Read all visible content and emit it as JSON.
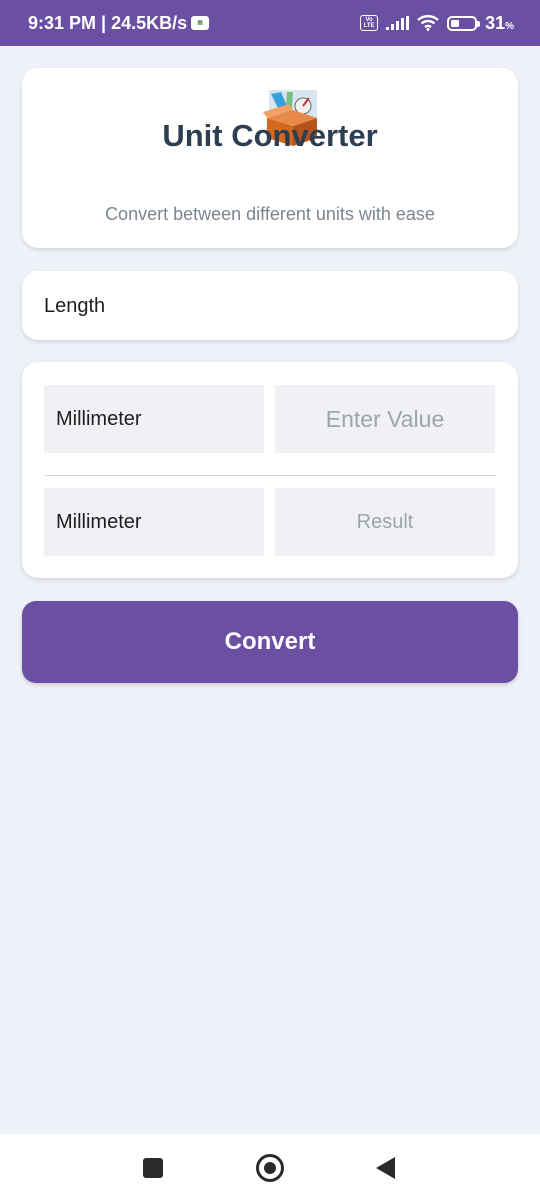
{
  "status_bar": {
    "time_speed": "9:31 PM | 24.5KB/s",
    "volte_top": "Vo",
    "volte_bottom": "LTE",
    "battery": "31",
    "battery_unit": "%"
  },
  "header": {
    "title": "Unit Converter",
    "subtitle": "Convert between different units with ease",
    "logo_icon": "unit-converter-logo-icon"
  },
  "category": {
    "selected": "Length"
  },
  "converter": {
    "from_unit": "Millimeter",
    "from_value": "",
    "from_placeholder": "Enter Value",
    "to_unit": "Millimeter",
    "result_placeholder": "Result"
  },
  "actions": {
    "convert_label": "Convert"
  },
  "colors": {
    "primary": "#6a4fa3",
    "background": "#eef1f7",
    "title": "#2c3e50"
  }
}
